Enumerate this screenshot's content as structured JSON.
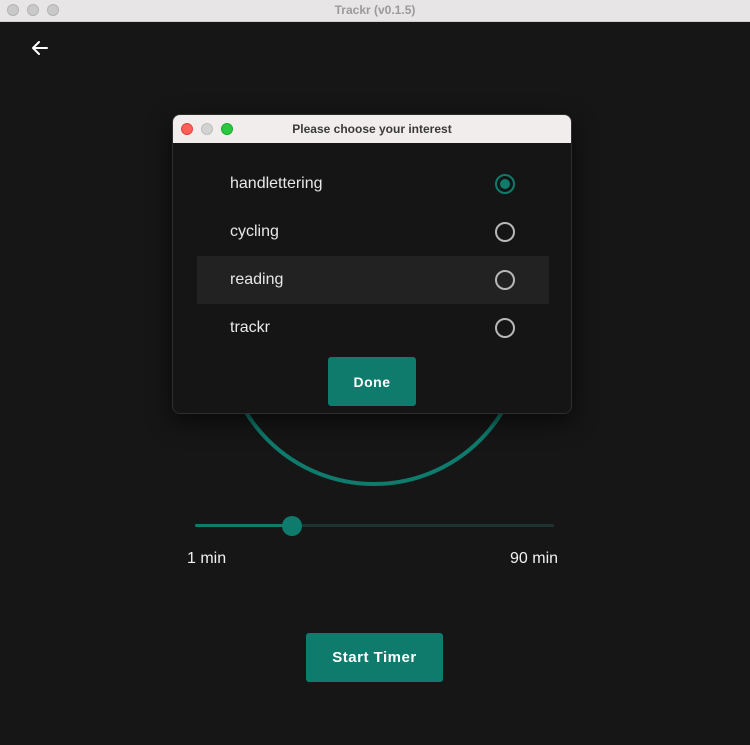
{
  "window": {
    "title": "Trackr (v0.1.5)"
  },
  "colors": {
    "accent": "#0e7b6c",
    "background": "#161616"
  },
  "icons": {
    "back": "arrow-left-icon"
  },
  "timer": {
    "min_label": "1 min",
    "max_label": "90 min",
    "slider_fraction": 0.27,
    "start_label": "Start Timer"
  },
  "dialog": {
    "title": "Please choose your interest",
    "options": [
      {
        "label": "handlettering",
        "selected": true
      },
      {
        "label": "cycling",
        "selected": false
      },
      {
        "label": "reading",
        "selected": false
      },
      {
        "label": "trackr",
        "selected": false
      }
    ],
    "done_label": "Done"
  }
}
